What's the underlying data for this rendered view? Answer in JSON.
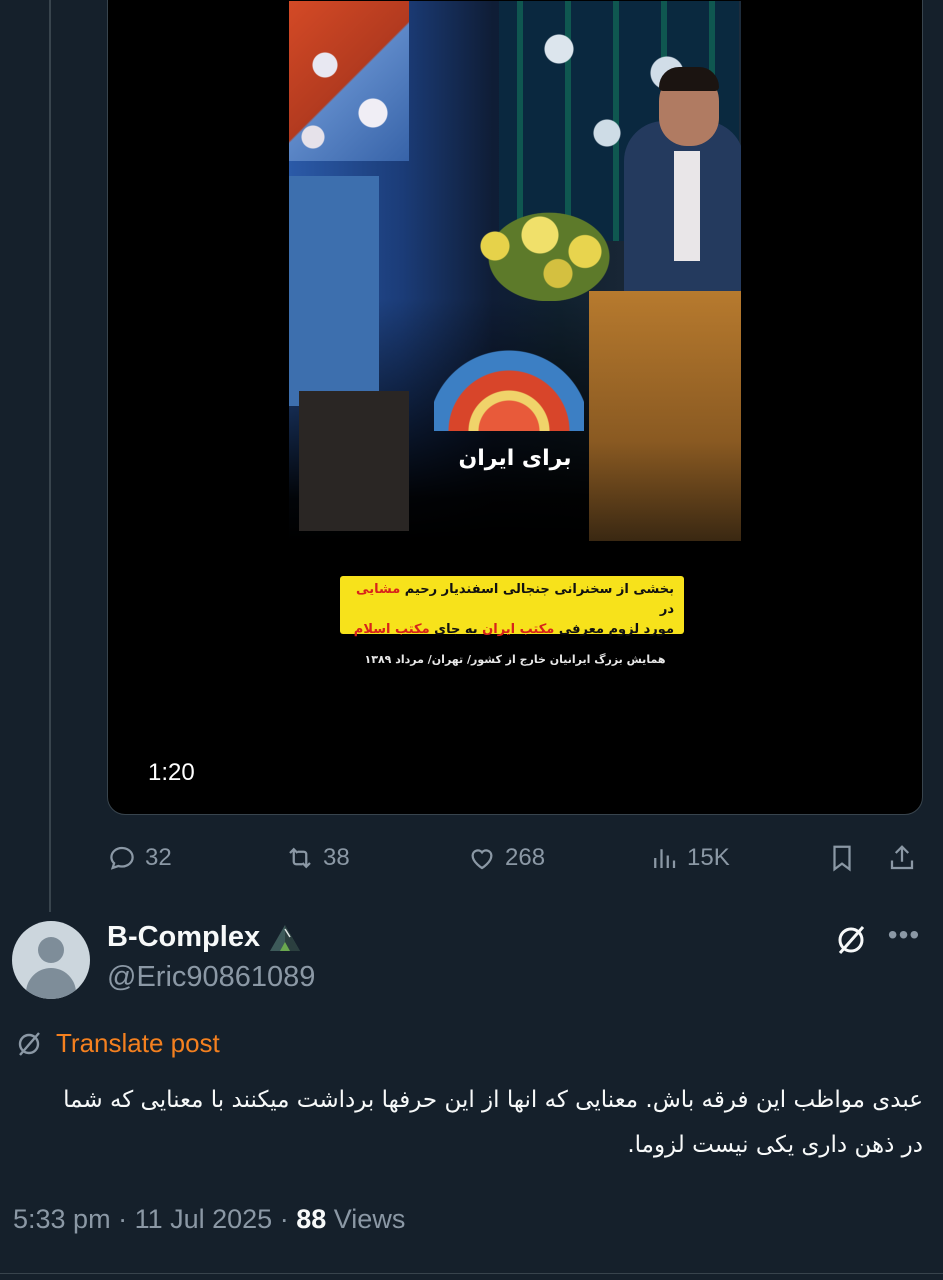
{
  "video": {
    "caption": "برای ایران",
    "yellow_line1_a": "بخشی از سخنرانی جنجالی اسفندیار رحیم ",
    "yellow_line1_red": "مشایی",
    "yellow_line1_b": " در",
    "yellow_line2_a": "مورد لزوم معرفی ",
    "yellow_line2_red1": "مکتب ایران",
    "yellow_line2_b": " به جای ",
    "yellow_line2_red2": "مکتب اسلام",
    "event_line": "همایش بزرگ ایرانیان خارج از کشور/ تهران/ مرداد ۱۳۸۹",
    "duration": "1:20"
  },
  "actions": {
    "replies": "32",
    "reposts": "38",
    "likes": "268",
    "views": "15K"
  },
  "reply": {
    "display_name": "B-Complex",
    "handle": "@Eric90861089",
    "translate_label": "Translate post",
    "text": "عبدی مواظب این فرقه باش. معنایی که انها از این حرفها برداشت میکنند با معنایی که شما در ذهن داری یکی نیست لزوما.",
    "time": "5:33 pm",
    "date": "11 Jul 2025",
    "views_count": "88",
    "views_label": "Views"
  },
  "colors": {
    "background": "#15202b",
    "secondary_text": "#8b98a5",
    "translate_accent": "#f4801f",
    "caption_box": "#f7e21b"
  }
}
